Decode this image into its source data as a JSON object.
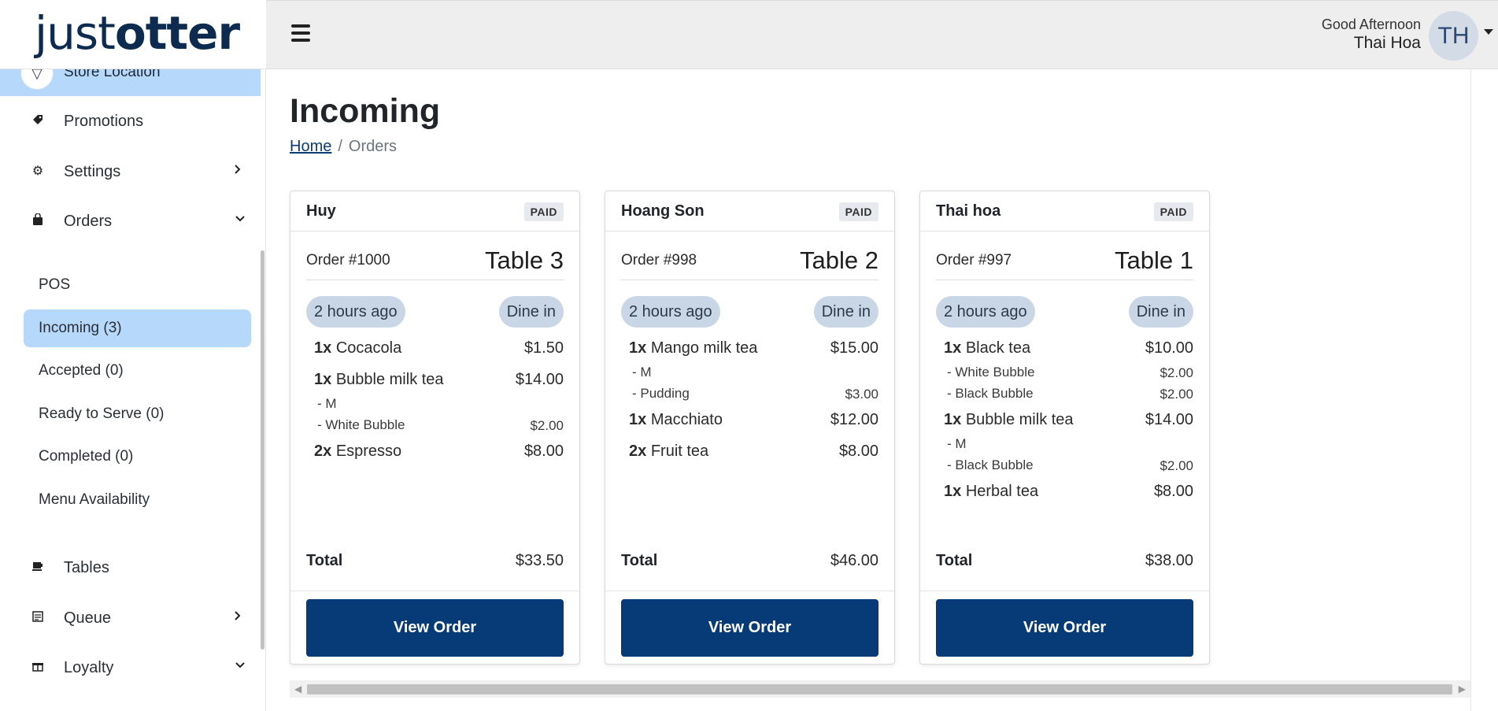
{
  "app": {
    "logo_light": "just",
    "logo_bold": "otter"
  },
  "sidebar": {
    "store_location": "Store Location",
    "items": [
      {
        "label": "Promotions",
        "icon": "tag-icon"
      },
      {
        "label": "Settings",
        "icon": "gear-icon"
      },
      {
        "label": "Orders",
        "icon": "bag-icon"
      },
      {
        "label": "Tables",
        "icon": "table-icon"
      },
      {
        "label": "Queue",
        "icon": "queue-icon"
      },
      {
        "label": "Loyalty",
        "icon": "gift-icon"
      }
    ],
    "orders_sub": [
      {
        "label": "POS"
      },
      {
        "label": "Incoming (3)"
      },
      {
        "label": "Accepted (0)"
      },
      {
        "label": "Ready to Serve (0)"
      },
      {
        "label": "Completed (0)"
      },
      {
        "label": "Menu Availability"
      }
    ]
  },
  "header": {
    "greeting": "Good Afternoon",
    "user_name": "Thai Hoa",
    "avatar_initials": "TH"
  },
  "main": {
    "title": "Incoming",
    "breadcrumb_home": "Home",
    "breadcrumb_sep": "/",
    "breadcrumb_current": "Orders"
  },
  "orders": [
    {
      "customer": "Huy",
      "status": "PAID",
      "order_no": "Order #1000",
      "table": "Table 3",
      "time": "2 hours ago",
      "type": "Dine in",
      "items": [
        {
          "qty": "1x",
          "name": "Cocacola",
          "price": "$1.50",
          "mods": []
        },
        {
          "qty": "1x",
          "name": "Bubble milk tea",
          "price": "$14.00",
          "mods": [
            {
              "name": "- M",
              "price": ""
            },
            {
              "name": "- White Bubble",
              "price": "$2.00"
            }
          ]
        },
        {
          "qty": "2x",
          "name": "Espresso",
          "price": "$8.00",
          "mods": []
        }
      ],
      "total_label": "Total",
      "total": "$33.50",
      "button": "View Order"
    },
    {
      "customer": "Hoang Son",
      "status": "PAID",
      "order_no": "Order #998",
      "table": "Table 2",
      "time": "2 hours ago",
      "type": "Dine in",
      "items": [
        {
          "qty": "1x",
          "name": "Mango milk tea",
          "price": "$15.00",
          "mods": [
            {
              "name": "- M",
              "price": ""
            },
            {
              "name": "- Pudding",
              "price": "$3.00"
            }
          ]
        },
        {
          "qty": "1x",
          "name": "Macchiato",
          "price": "$12.00",
          "mods": []
        },
        {
          "qty": "2x",
          "name": "Fruit tea",
          "price": "$8.00",
          "mods": []
        }
      ],
      "total_label": "Total",
      "total": "$46.00",
      "button": "View Order"
    },
    {
      "customer": "Thai hoa",
      "status": "PAID",
      "order_no": "Order #997",
      "table": "Table 1",
      "time": "2 hours ago",
      "type": "Dine in",
      "items": [
        {
          "qty": "1x",
          "name": "Black tea",
          "price": "$10.00",
          "mods": [
            {
              "name": "- White Bubble",
              "price": "$2.00"
            },
            {
              "name": "- Black Bubble",
              "price": "$2.00"
            }
          ]
        },
        {
          "qty": "1x",
          "name": "Bubble milk tea",
          "price": "$14.00",
          "mods": [
            {
              "name": "- M",
              "price": ""
            },
            {
              "name": "- Black Bubble",
              "price": "$2.00"
            }
          ]
        },
        {
          "qty": "1x",
          "name": "Herbal tea",
          "price": "$8.00",
          "mods": []
        }
      ],
      "total_label": "Total",
      "total": "$38.00",
      "button": "View Order"
    }
  ],
  "colors": {
    "brand_navy": "#063b78",
    "active_nav": "#b5d8fb",
    "pill": "#c9d6e6"
  }
}
